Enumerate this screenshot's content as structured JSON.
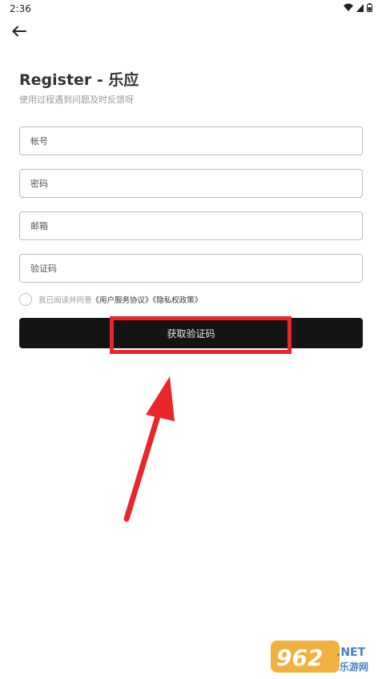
{
  "status_bar": {
    "time": "2:36"
  },
  "header": {
    "title": "Register - 乐应",
    "subtitle": "使用过程遇到问题及时反馈呀"
  },
  "form": {
    "account_placeholder": "帐号",
    "password_placeholder": "密码",
    "email_placeholder": "邮箱",
    "code_placeholder": "验证码"
  },
  "agreement": {
    "prefix": "我已阅读并同意",
    "terms_link": "《用户服务协议》",
    "privacy_link": "《隐私权政策》"
  },
  "actions": {
    "get_code_label": "获取验证码"
  },
  "annotation": {
    "color": "#e8262c"
  },
  "watermark": {
    "brand": "962",
    "net": ".NET",
    "site": "乐游网"
  }
}
